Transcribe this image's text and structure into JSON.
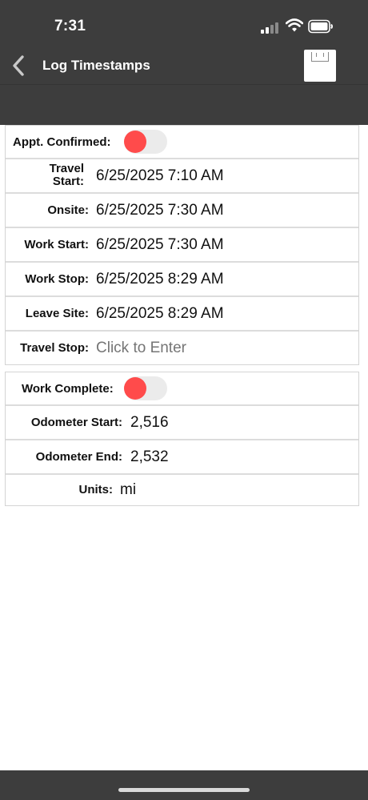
{
  "status_bar": {
    "time": "7:31"
  },
  "nav": {
    "title": "Log Timestamps",
    "back_icon": "chevron-left-icon",
    "save_icon": "floppy-disk-icon"
  },
  "timestamps": {
    "appt_confirmed": {
      "label": "Appt. Confirmed:",
      "toggle_on": false,
      "toggle_color": "#ff4b4b"
    },
    "travel_start": {
      "label_line1": "Travel",
      "label_line2": "Start:",
      "value": "6/25/2025 7:10 AM"
    },
    "onsite": {
      "label": "Onsite:",
      "value": "6/25/2025 7:30 AM"
    },
    "work_start": {
      "label": "Work Start:",
      "value": "6/25/2025 7:30 AM"
    },
    "work_stop": {
      "label": "Work Stop:",
      "value": "6/25/2025 8:29 AM"
    },
    "leave_site": {
      "label": "Leave Site:",
      "value": "6/25/2025 8:29 AM"
    },
    "travel_stop": {
      "label": "Travel Stop:",
      "placeholder": "Click to Enter"
    }
  },
  "completion": {
    "work_complete": {
      "label": "Work Complete:",
      "toggle_on": false,
      "toggle_color": "#ff4b4b"
    },
    "odometer_start": {
      "label": "Odometer Start:",
      "value": "2,516"
    },
    "odometer_end": {
      "label": "Odometer End:",
      "value": "2,532"
    },
    "units": {
      "label": "Units:",
      "value": "mi"
    }
  },
  "colors": {
    "header_bg": "#3d3d3d",
    "toggle_off_knob": "#ff4b4b"
  }
}
